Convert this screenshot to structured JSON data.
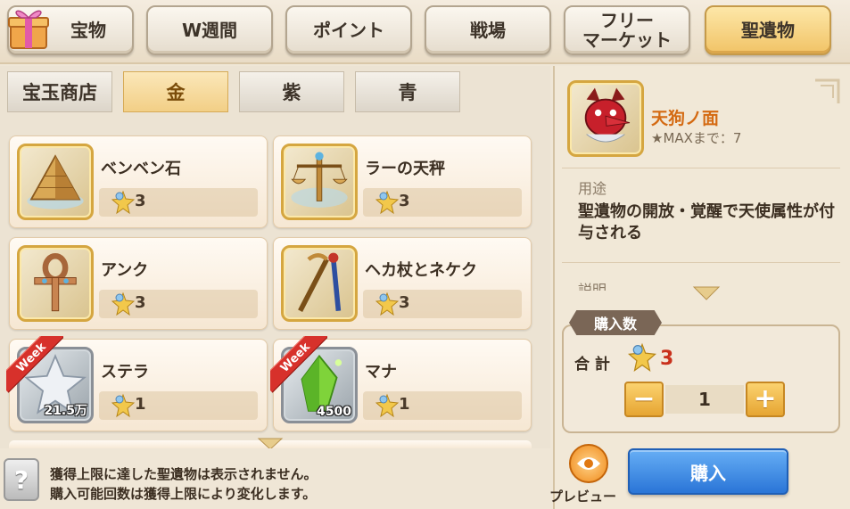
{
  "tabs": [
    {
      "label": "宝物",
      "active": false
    },
    {
      "label": "W週間",
      "active": false
    },
    {
      "label": "ポイント",
      "active": false
    },
    {
      "label": "戦場",
      "active": false
    },
    {
      "label": "フリー\nマーケット",
      "active": false
    },
    {
      "label": "聖遺物",
      "active": true
    }
  ],
  "subtabs": [
    {
      "label": "宝玉商店",
      "active": false
    },
    {
      "label": "金",
      "active": true
    },
    {
      "label": "紫",
      "active": false
    },
    {
      "label": "青",
      "active": false
    }
  ],
  "items": [
    {
      "name": "ベンベン石",
      "price": "3",
      "icon": "pyramid-icon",
      "week": false
    },
    {
      "name": "ラーの天秤",
      "price": "3",
      "icon": "scale-icon",
      "week": false
    },
    {
      "name": "アンク",
      "price": "3",
      "icon": "ankh-icon",
      "week": false
    },
    {
      "name": "ヘカ杖とネケク",
      "price": "3",
      "icon": "staff-icon",
      "week": false
    },
    {
      "name": "ステラ",
      "price": "1",
      "icon": "star-icon",
      "week": true,
      "week_label": "Week",
      "qty": "21.5万"
    },
    {
      "name": "マナ",
      "price": "1",
      "icon": "crystal-icon",
      "week": true,
      "week_label": "Week",
      "qty": "4500"
    }
  ],
  "footer": {
    "help_icon": "?",
    "line1": "獲得上限に達した聖遺物は表示されません。",
    "line2": "購入可能回数は獲得上限により変化します。"
  },
  "detail": {
    "name": "天狗ノ面",
    "max_text": "★MAXまで：7",
    "usage_label": "用途",
    "usage_text": "聖遺物の開放・覚醒で天使属性が付与される",
    "desc_label": "説明"
  },
  "purchase": {
    "label": "購入数",
    "total_label": "合 計",
    "total_value": "3",
    "minus": "−",
    "plus": "+",
    "quantity": "1",
    "preview_label": "プレビュー",
    "buy_label": "購入"
  },
  "colors": {
    "accent_gold": "#f1c366",
    "buy_blue": "#2a75d7",
    "week_red": "#d7312b",
    "price_red": "#c9311c",
    "detail_name": "#d46a12"
  }
}
